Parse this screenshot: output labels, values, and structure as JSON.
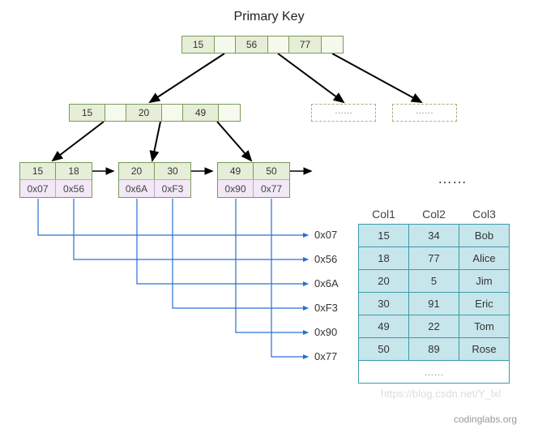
{
  "title": "Primary Key",
  "root": {
    "keys": [
      "15",
      "56",
      "77"
    ]
  },
  "internal": {
    "keys": [
      "15",
      "20",
      "49"
    ]
  },
  "leaves": [
    {
      "keys": [
        "15",
        "18"
      ],
      "ptrs": [
        "0x07",
        "0x56"
      ]
    },
    {
      "keys": [
        "20",
        "30"
      ],
      "ptrs": [
        "0x6A",
        "0xF3"
      ]
    },
    {
      "keys": [
        "49",
        "50"
      ],
      "ptrs": [
        "0x90",
        "0x77"
      ]
    }
  ],
  "ghost_text": "……",
  "leaf_ellipsis": "……",
  "pointer_labels": [
    "0x07",
    "0x56",
    "0x6A",
    "0xF3",
    "0x90",
    "0x77"
  ],
  "table": {
    "headers": [
      "Col1",
      "Col2",
      "Col3"
    ],
    "rows": [
      [
        "15",
        "34",
        "Bob"
      ],
      [
        "18",
        "77",
        "Alice"
      ],
      [
        "20",
        "5",
        "Jim"
      ],
      [
        "30",
        "91",
        "Eric"
      ],
      [
        "49",
        "22",
        "Tom"
      ],
      [
        "50",
        "89",
        "Rose"
      ]
    ],
    "lastrow_text": "……"
  },
  "watermark": "https://blog.csdn.net/Y_lxl",
  "credit": "codinglabs.org"
}
